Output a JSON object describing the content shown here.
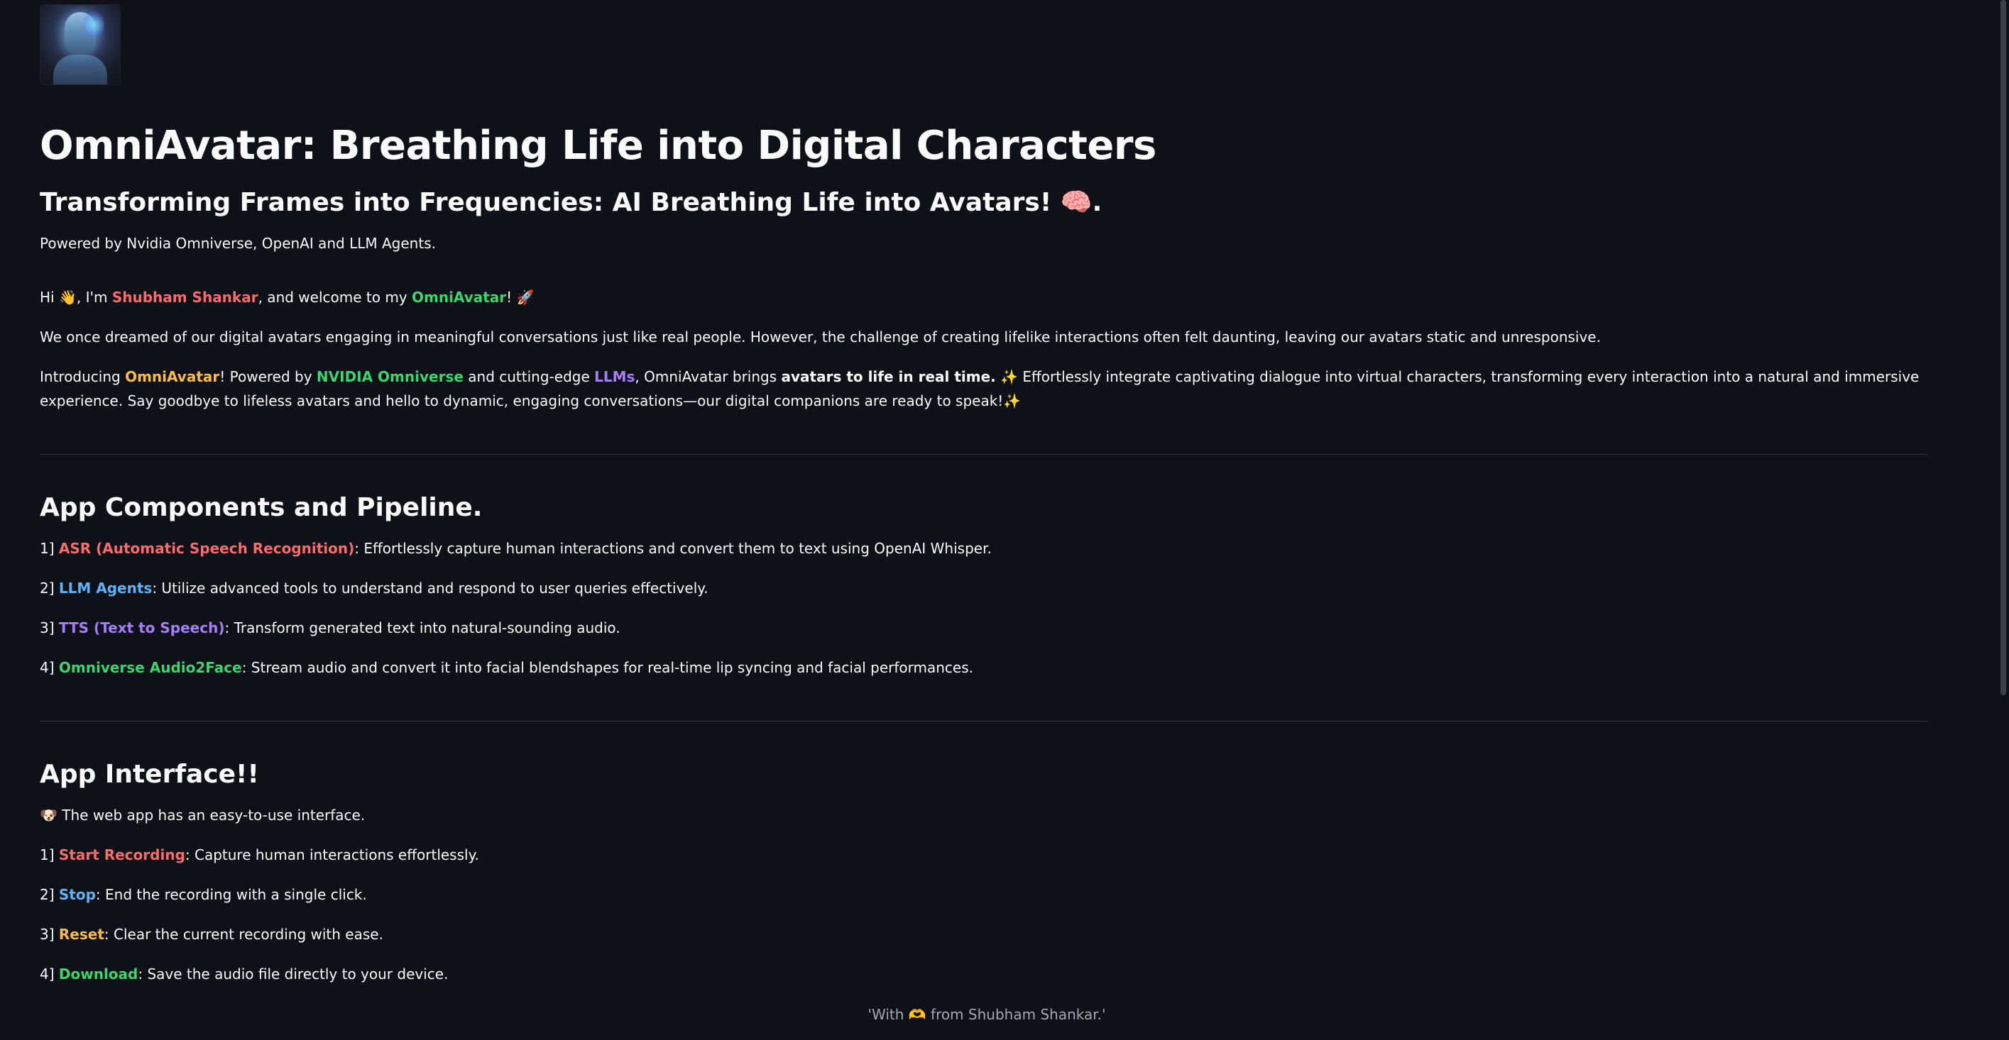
{
  "header": {
    "title": "OmniAvatar: Breathing Life into Digital Characters",
    "subtitle_text": "Transforming Frames into Frequencies: AI Breathing Life into Avatars! ",
    "subtitle_emoji": "🧠",
    "subtitle_end": ".",
    "powered_by": "Powered by Nvidia Omniverse, OpenAI and LLM Agents."
  },
  "intro": {
    "greeting_1": "Hi ",
    "greeting_wave": "👋",
    "greeting_2": ", I'm ",
    "name": "Shubham Shankar",
    "greeting_3": ", and welcome to my ",
    "app_name": "OmniAvatar",
    "greeting_4": "! ",
    "greeting_rocket": "🚀",
    "dream_text": "We once dreamed of our digital avatars engaging in meaningful conversations just like real people. However, the challenge of creating lifelike interactions often felt daunting, leaving our avatars static and unresponsive.",
    "introducing_1": "Introducing ",
    "introducing_app": "OmniAvatar",
    "introducing_2": "! Powered by ",
    "introducing_nvidia": "NVIDIA Omniverse",
    "introducing_3": " and cutting-edge ",
    "introducing_llms": "LLMs",
    "introducing_4": ", OmniAvatar brings ",
    "introducing_bold": "avatars to life in real time.",
    "introducing_sparkle_1": " ✨",
    "introducing_5": " Effortlessly integrate captivating dialogue into virtual characters, transforming every interaction into a natural and immersive experience. Say goodbye to lifeless avatars and hello to dynamic, engaging conversations—our digital companions are ready to speak!",
    "introducing_sparkle_2": "✨"
  },
  "components": {
    "heading": "App Components and Pipeline.",
    "items": [
      {
        "prefix": "1] ",
        "name": "ASR (Automatic Speech Recognition)",
        "desc": ": Effortlessly capture human interactions and convert them to text using OpenAI Whisper.",
        "color": "#ff6c6c"
      },
      {
        "prefix": "2] ",
        "name": "LLM Agents",
        "desc": ": Utilize advanced tools to understand and respond to user queries effectively.",
        "color": "#60b4ff"
      },
      {
        "prefix": "3] ",
        "name": "TTS (Text to Speech)",
        "desc": ": Transform generated text into natural-sounding audio.",
        "color": "#a57fff"
      },
      {
        "prefix": "4] ",
        "name": "Omniverse Audio2Face",
        "desc": ": Stream audio and convert it into facial blendshapes for real-time lip syncing and facial performances.",
        "color": "#3dd56d"
      }
    ]
  },
  "interface": {
    "heading": "App Interface!!",
    "intro_emoji": "🐶",
    "intro_text": " The web app has an easy-to-use interface.",
    "items": [
      {
        "prefix": "1] ",
        "name": "Start Recording",
        "desc": ": Capture human interactions effortlessly.",
        "color": "#ff6c6c"
      },
      {
        "prefix": "2] ",
        "name": "Stop",
        "desc": ": End the recording with a single click.",
        "color": "#60b4ff"
      },
      {
        "prefix": "3] ",
        "name": "Reset",
        "desc": ": Clear the current recording with ease.",
        "color": "#ffbd45"
      },
      {
        "prefix": "4] ",
        "name": "Download",
        "desc": ": Save the audio file directly to your device.",
        "color": "#3dd56d"
      }
    ]
  },
  "footer": {
    "text_1": "'With ",
    "emoji": "🫶",
    "text_2": " from Shubham Shankar.'"
  }
}
